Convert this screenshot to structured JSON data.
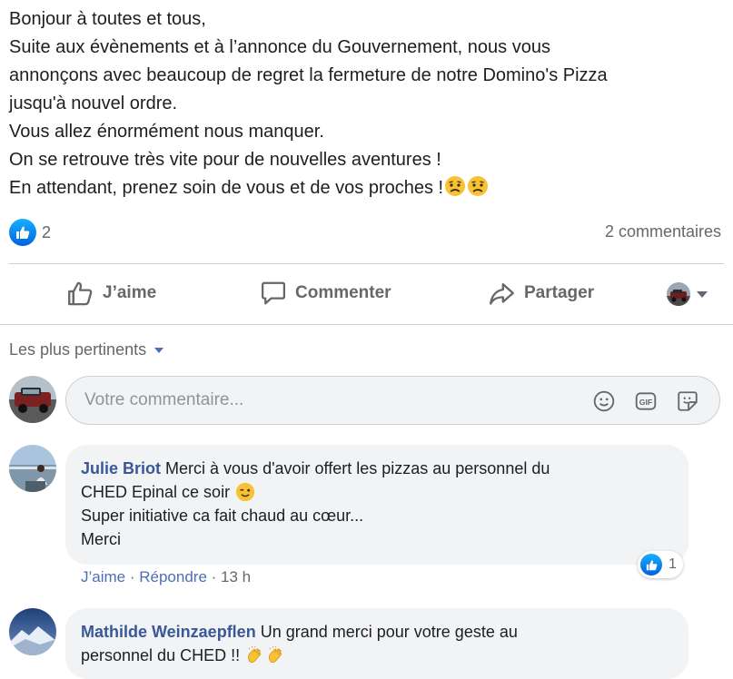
{
  "post": {
    "lines": [
      "Bonjour à toutes et tous,",
      "Suite aux évènements et à l’annonce du Gouvernement, nous vous",
      "annonçons avec beaucoup de regret la fermeture de notre Domino's Pizza",
      "jusqu'à nouvel ordre.",
      "Vous allez énormément nous manquer.",
      "On se retrouve très vite pour de nouvelles aventures !",
      "En attendant, prenez soin de vous et de vos proches !"
    ],
    "reactions_count": "2",
    "comments_count": "2 commentaires"
  },
  "actions": {
    "like": "J’aime",
    "comment": "Commenter",
    "share": "Partager"
  },
  "sort_label": "Les plus pertinents",
  "comment_input": {
    "placeholder": "Votre commentaire..."
  },
  "comments": [
    {
      "author": "Julie Briot",
      "lines": [
        "Merci à vous d'avoir offert les pizzas au personnel du",
        "CHED Epinal ce soir",
        "Super initiative ca fait chaud au cœur...",
        "Merci"
      ],
      "like_action": "J’aime",
      "reply_action": "Répondre",
      "time": "13 h",
      "reactions_count": "1"
    },
    {
      "author": "Mathilde Weinzaepflen",
      "lines": [
        "Un grand merci pour votre geste au",
        "personnel du CHED !!"
      ]
    }
  ],
  "colors": {
    "like_blue": "#1877f2",
    "link_blue": "#385898",
    "muted_gray": "#65676b",
    "bubble_bg": "#f2f3f5"
  }
}
